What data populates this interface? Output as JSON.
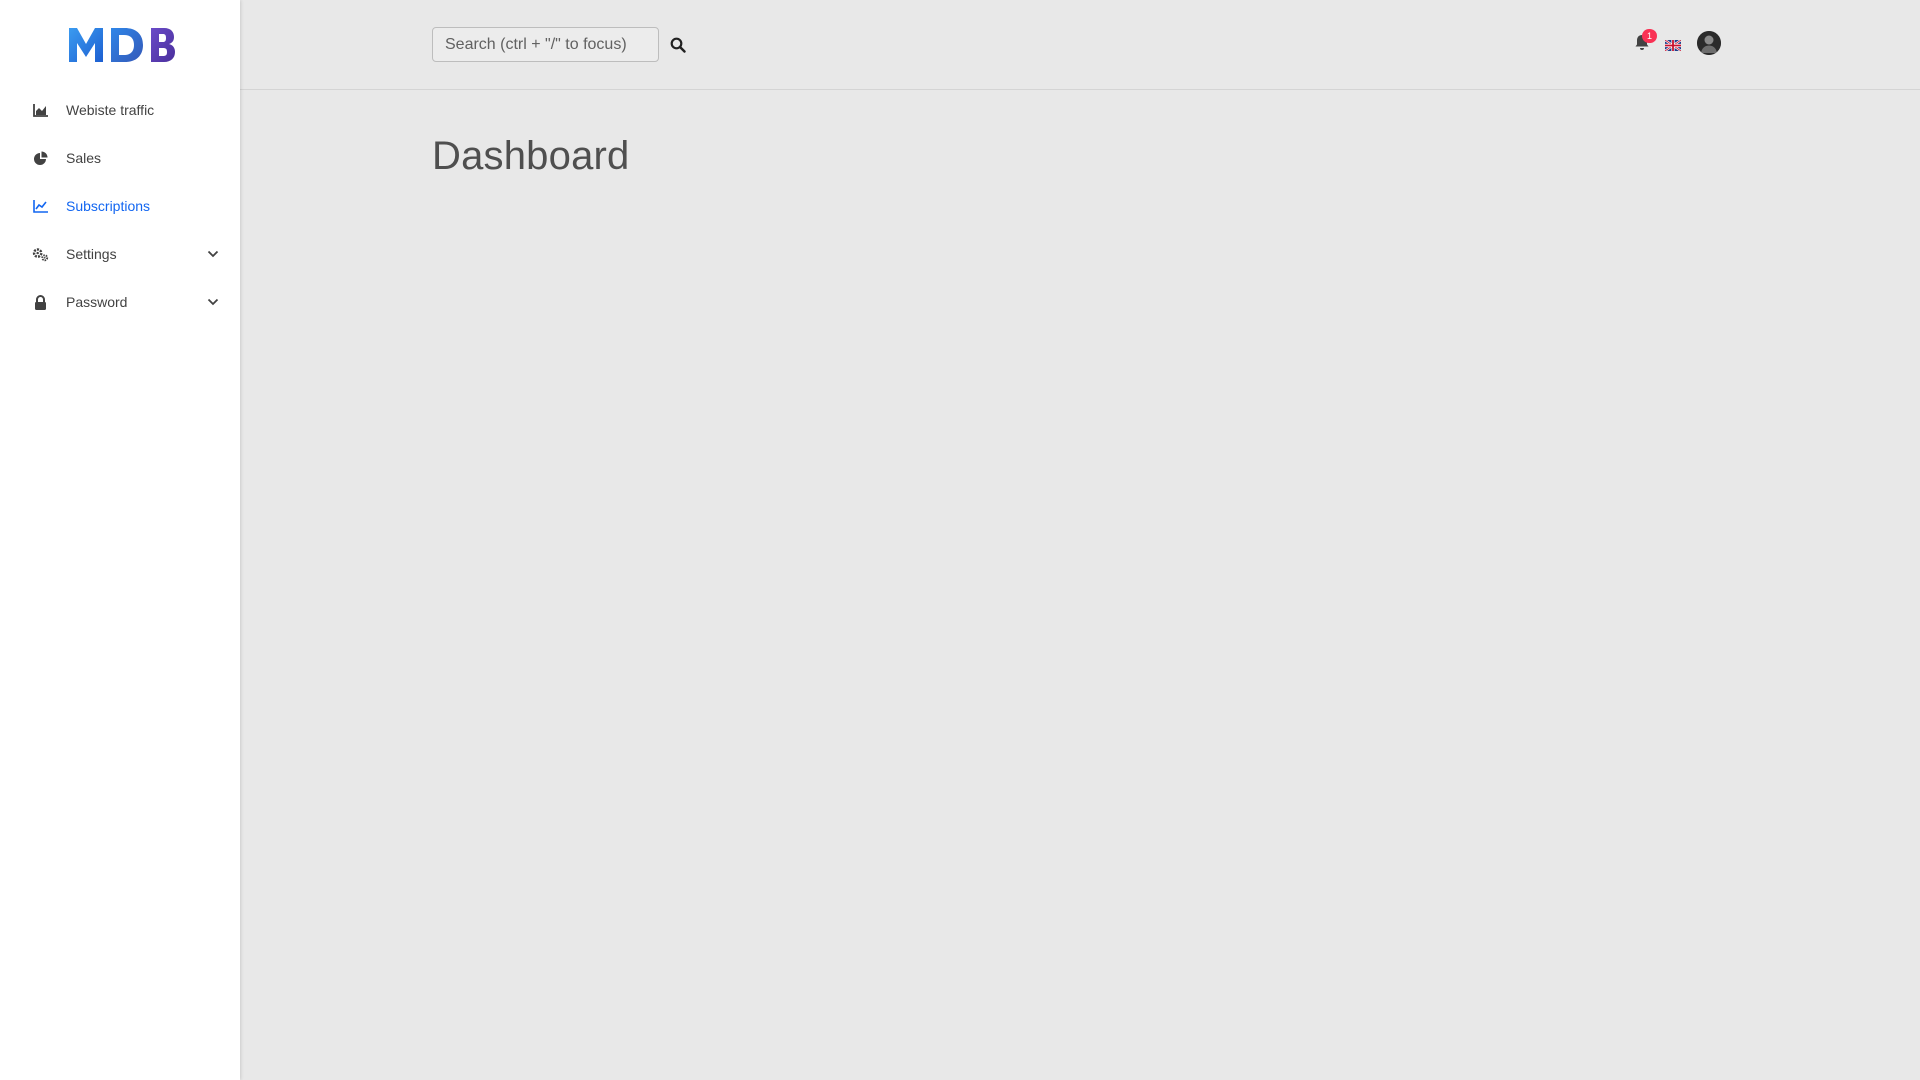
{
  "brand": {
    "logo_text": "MDB"
  },
  "sidebar": {
    "items": [
      {
        "label": "Webiste traffic",
        "icon": "area-chart-icon",
        "active": false,
        "expandable": false
      },
      {
        "label": "Sales",
        "icon": "pie-chart-icon",
        "active": false,
        "expandable": false
      },
      {
        "label": "Subscriptions",
        "icon": "line-chart-icon",
        "active": true,
        "expandable": false
      },
      {
        "label": "Settings",
        "icon": "cogs-icon",
        "active": false,
        "expandable": true
      },
      {
        "label": "Password",
        "icon": "lock-icon",
        "active": false,
        "expandable": true
      }
    ]
  },
  "topbar": {
    "search": {
      "placeholder": "Search (ctrl + \"/\" to focus)",
      "value": ""
    },
    "notifications": {
      "count": "1"
    },
    "language": "en-gb-flag-icon",
    "avatar": "user-avatar"
  },
  "main": {
    "title": "Dashboard"
  },
  "colors": {
    "accent": "#1266f1",
    "badge": "#f93154",
    "background": "#e8e8e8",
    "sidebar": "#ffffff",
    "text": "#424242"
  }
}
